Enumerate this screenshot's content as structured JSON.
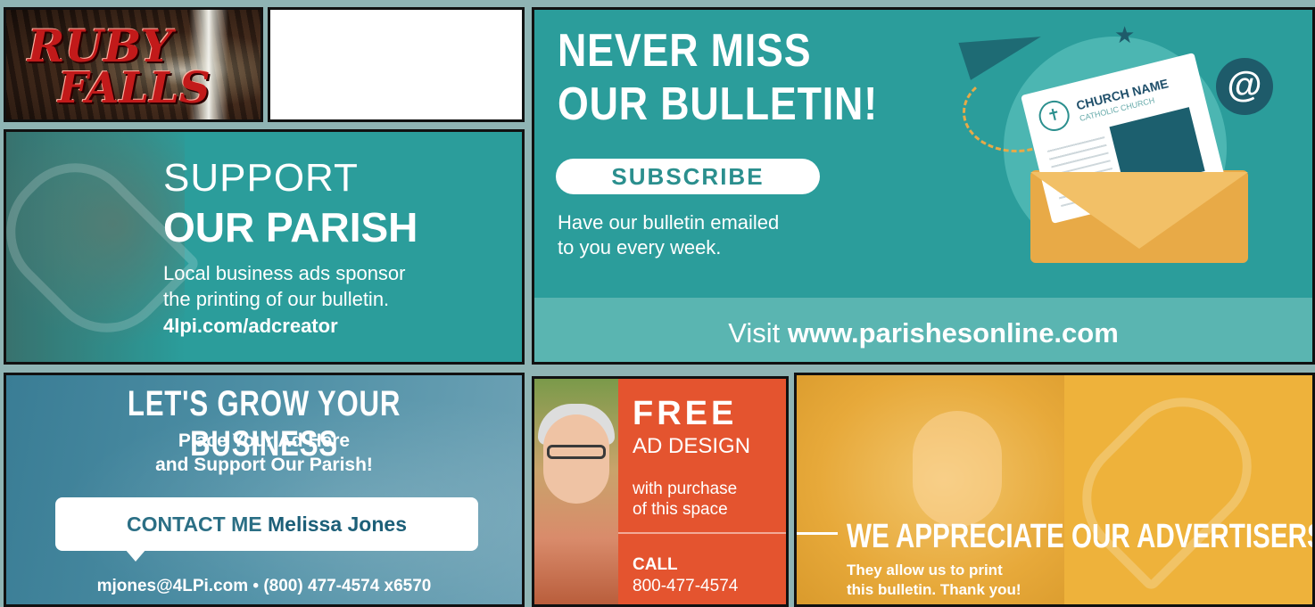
{
  "ruby_falls": {
    "logo_line1": "RUBY",
    "logo_line2": "FALLS"
  },
  "support_parish": {
    "line1": "SUPPORT",
    "line2": "OUR PARISH",
    "body1": "Local business ads sponsor",
    "body2": "the printing of our bulletin.",
    "link": "4lpi.com/adcreator"
  },
  "bulletin": {
    "heading1": "NEVER MISS",
    "heading2": "OUR BULLETIN!",
    "subscribe_label": "SUBSCRIBE",
    "desc1": "Have our bulletin emailed",
    "desc2": "to you every week.",
    "visit_prefix": "Visit",
    "visit_url": "www.parishesonline.com",
    "church_name": "CHURCH NAME",
    "church_sub": "CATHOLIC CHURCH",
    "at_symbol": "@"
  },
  "grow": {
    "heading": "LET'S GROW YOUR BUSINESS",
    "sub1": "Place Your Ad Here",
    "sub2": "and Support Our Parish!",
    "contact_label": "CONTACT ME",
    "contact_name": "Melissa Jones",
    "contact_info": "mjones@4LPi.com • (800) 477-4574 x6570"
  },
  "free_ad": {
    "line1": "FREE",
    "line2": "AD DESIGN",
    "line3": "with purchase",
    "line4": "of this space",
    "call_label": "CALL",
    "phone": "800-477-4574"
  },
  "appreciate": {
    "heading": "WE APPRECIATE OUR ADVERTISERS!",
    "sub1": "They allow us to print",
    "sub2": "this bulletin. Thank you!"
  },
  "colors": {
    "teal": "#2b9d9b",
    "orange": "#e4542f",
    "gold": "#eeb23b",
    "slate": "#4f90a6"
  }
}
